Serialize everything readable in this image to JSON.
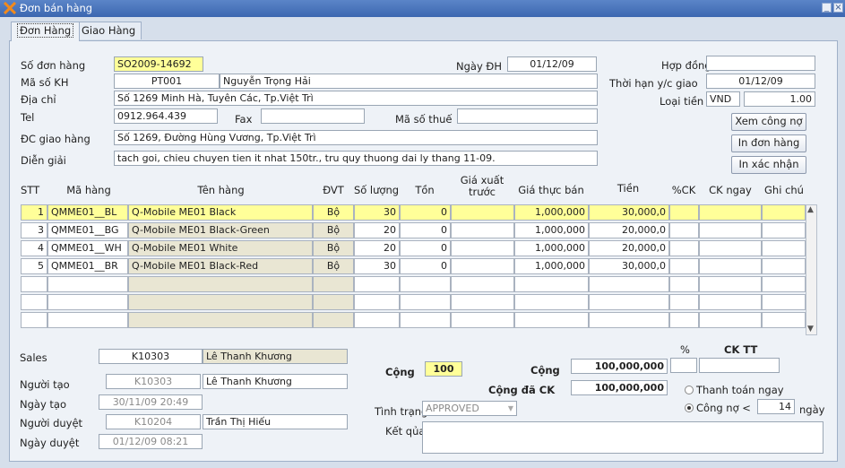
{
  "window": {
    "title": "Đơn bán hàng"
  },
  "tabs": [
    {
      "label": "Đơn Hàng"
    },
    {
      "label": "Giao Hàng"
    }
  ],
  "header": {
    "so_don_hang": {
      "label": "Số đơn hàng",
      "value": "SO2009-14692"
    },
    "ma_kh": {
      "label": "Mã số KH",
      "code": "PT001",
      "name": "Nguyễn Trọng Hải"
    },
    "dia_chi": {
      "label": "Địa chỉ",
      "value": "Số 1269 Minh Hà, Tuyên Các, Tp.Việt Trì"
    },
    "tel": {
      "label": "Tel",
      "value": "0912.964.439"
    },
    "fax": {
      "label": "Fax",
      "value": ""
    },
    "ma_so_thue": {
      "label": "Mã số thuế",
      "value": ""
    },
    "dc_giao_hang": {
      "label": "ĐC giao hàng",
      "value": "Số 1269, Đường Hùng Vương, Tp.Việt Trì"
    },
    "dien_giai": {
      "label": "Diễn giải",
      "value": "tach goi, chieu chuyen tien it nhat 150tr., tru quy thuong dai ly thang 11-09."
    },
    "ngay_dh": {
      "label": "Ngày ĐH",
      "value": "01/12/09"
    },
    "hop_dong": {
      "label": "Hợp đồng",
      "value": ""
    },
    "thoi_han": {
      "label": "Thời hạn y/c giao",
      "value": "01/12/09"
    },
    "loai_tien": {
      "label": "Loại tiền",
      "currency": "VND",
      "rate": "1.00"
    },
    "buttons": {
      "xem_cong_no": "Xem công nợ",
      "in_don_hang": "In đơn hàng",
      "in_xac_nhan": "In xác nhận"
    }
  },
  "table": {
    "headers": {
      "stt": "STT",
      "ma_hang": "Mã hàng",
      "ten_hang": "Tên hàng",
      "dvt": "ĐVT",
      "so_luong": "Số lượng",
      "ton": "Tồn",
      "gia_xuat_truoc": "Giá xuất trước",
      "gia_thuc_ban": "Giá thực bán",
      "tien": "Tiền",
      "pct_ck": "%CK",
      "ck_ngay": "CK ngay",
      "ghi_chu": "Ghi chú"
    },
    "rows": [
      {
        "stt": "1",
        "ma_hang": "QMME01__BL",
        "ten_hang": "Q-Mobile ME01 Black",
        "dvt": "Bộ",
        "so_luong": "30",
        "ton": "0",
        "gia_xuat_truoc": "",
        "gia_thuc_ban": "1,000,000",
        "tien": "30,000,0",
        "pct_ck": "",
        "ck_ngay": "",
        "ghi_chu": ""
      },
      {
        "stt": "3",
        "ma_hang": "QMME01__BG",
        "ten_hang": "Q-Mobile ME01 Black-Green",
        "dvt": "Bộ",
        "so_luong": "20",
        "ton": "0",
        "gia_xuat_truoc": "",
        "gia_thuc_ban": "1,000,000",
        "tien": "20,000,0",
        "pct_ck": "",
        "ck_ngay": "",
        "ghi_chu": ""
      },
      {
        "stt": "4",
        "ma_hang": "QMME01__WH",
        "ten_hang": "Q-Mobile ME01 White",
        "dvt": "Bộ",
        "so_luong": "20",
        "ton": "0",
        "gia_xuat_truoc": "",
        "gia_thuc_ban": "1,000,000",
        "tien": "20,000,0",
        "pct_ck": "",
        "ck_ngay": "",
        "ghi_chu": ""
      },
      {
        "stt": "5",
        "ma_hang": "QMME01__BR",
        "ten_hang": "Q-Mobile ME01 Black-Red",
        "dvt": "Bộ",
        "so_luong": "30",
        "ton": "0",
        "gia_xuat_truoc": "",
        "gia_thuc_ban": "1,000,000",
        "tien": "30,000,0",
        "pct_ck": "",
        "ck_ngay": "",
        "ghi_chu": ""
      }
    ]
  },
  "footer": {
    "sales": {
      "label": "Sales",
      "code": "K10303",
      "name": "Lê Thanh Khương"
    },
    "nguoi_tao": {
      "label": "Người tạo",
      "code": "K10303",
      "name": "Lê Thanh Khương"
    },
    "ngay_tao": {
      "label": "Ngày tạo",
      "value": "30/11/09 20:49"
    },
    "nguoi_duyet": {
      "label": "Người duyệt",
      "code": "K10204",
      "name": "Trần Thị Hiếu"
    },
    "ngay_duyet": {
      "label": "Ngày duyệt",
      "value": "01/12/09 08:21"
    },
    "cong_qty": {
      "label": "Cộng",
      "value": "100"
    },
    "cong_tien": {
      "label": "Cộng",
      "value": "100,000,000"
    },
    "cong_da_ck": {
      "label": "Cộng đã CK",
      "value": "100,000,000"
    },
    "pct": {
      "label": "%",
      "value": ""
    },
    "ck_tt": {
      "label": "CK TT",
      "value": ""
    },
    "tinh_trang": {
      "label": "Tình trạng",
      "value": "APPROVED"
    },
    "ket_qua": {
      "label": "Kết qủa",
      "value": ""
    },
    "thanh_toan_ngay": "Thanh toán ngay",
    "cong_no": {
      "label": "Công nợ <",
      "days": "14",
      "unit": "ngày"
    }
  },
  "colors": {
    "highlight": "#ffff99",
    "titlebar": "#3c67b0",
    "readonly": "#e9e6d3"
  }
}
